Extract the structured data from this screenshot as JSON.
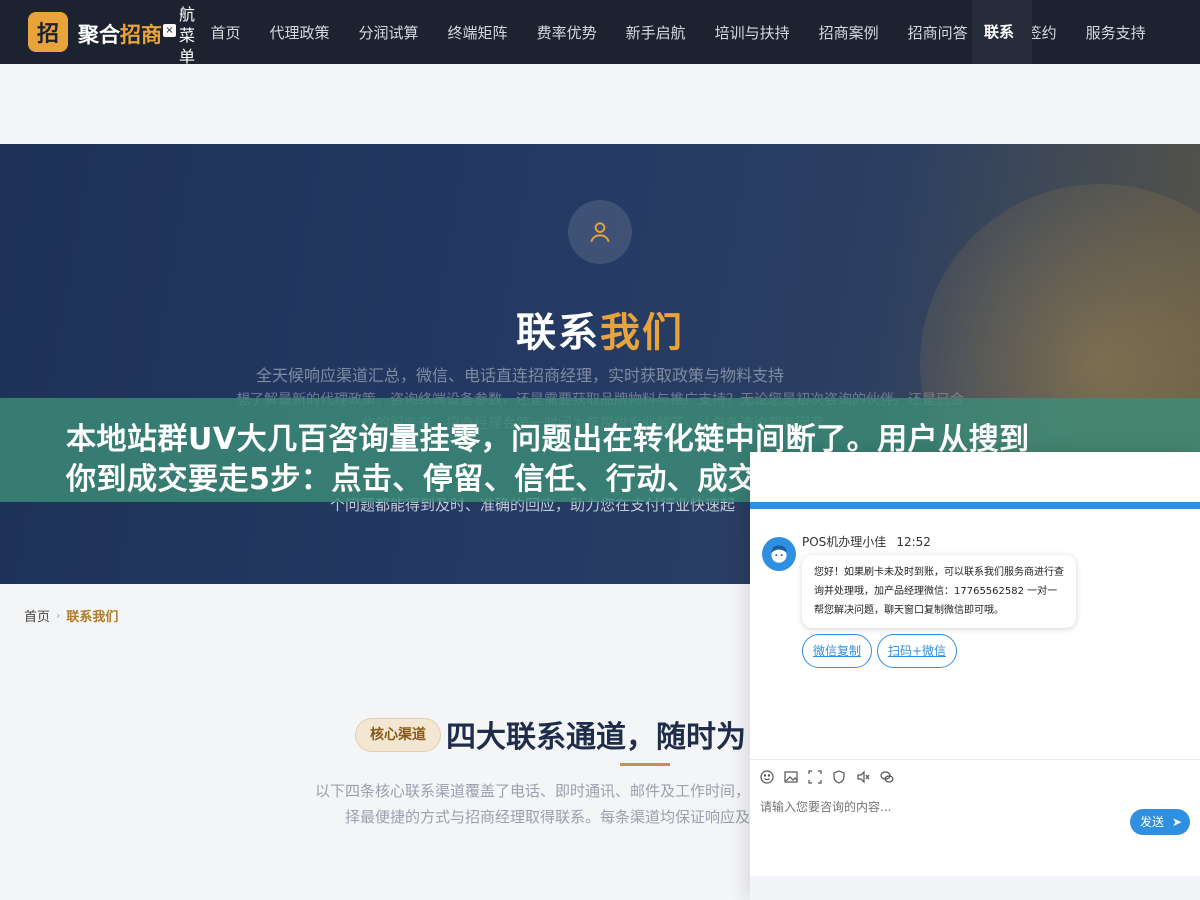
{
  "navbar": {
    "logo_mark": "招",
    "logo_text_plain": "聚合",
    "logo_text_accent": "招商",
    "close_glyph": "×",
    "toggle_label": "航菜单",
    "items": [
      {
        "label": "首页"
      },
      {
        "label": "代理政策"
      },
      {
        "label": "分润试算"
      },
      {
        "label": "终端矩阵"
      },
      {
        "label": "费率优势"
      },
      {
        "label": "新手启航"
      },
      {
        "label": "培训与扶持"
      },
      {
        "label": "招商案例"
      },
      {
        "label": "招商问答"
      },
      {
        "label": "在线签约"
      },
      {
        "label": "服务支持"
      }
    ],
    "active_item": "联系"
  },
  "hero": {
    "title_plain": "联系",
    "title_accent": "我们",
    "subtitle": "全天候响应渠道汇总，微信、电话直连招商经理，实时获取政策与物料支持",
    "description": "想了解最新的代理政策、咨询终端设备参数，还是需要获取品牌物料与推广支持？无论您是初次咨询的伙伴，还是已合作的服务商，招商经理会第一时间为您提供专业解答，让每条咨询都有回音。",
    "description_last": "个问题都能得到及时、准确的回应，助力您在支付行业快速起"
  },
  "ad_banner": {
    "line1": "本地站群UV大几百咨询量挂零，问题出在转化链中间断了。用户从搜到",
    "line2": "你到成交要走5步：点击、停留、信任、行动、成交。流量只解决了第一"
  },
  "breadcrumb": {
    "home": "首页",
    "separator": "›",
    "current": "联系我们"
  },
  "section": {
    "chip": "核心渠道",
    "title": "四大联系通道，随时为",
    "description": "以下四条核心联系渠道覆盖了电话、即时通讯、邮件及工作时间，您可根据自身需求选择最便捷的方式与招商经理取得联系。每条渠道均保证响应及时、服务专业。"
  },
  "chat": {
    "agent_name": "POS机办理小佳",
    "time": "12:52",
    "message": "您好！如果刷卡未及时到账，可以联系我们服务商进行查询并处理哦，加产品经理微信：17765562582 一对一帮您解决问题，聊天窗口复制微信即可哦。",
    "quick_replies": [
      "微信复制",
      "扫码+微信"
    ],
    "input_placeholder": "请输入您要咨询的内容...",
    "send_label": "发送",
    "minimize_glyph": "—",
    "maximize_glyph": "□",
    "tools": [
      "emoji-icon",
      "image-icon",
      "crop-icon",
      "shield-icon",
      "audio-icon",
      "wechat-icon"
    ]
  },
  "colors": {
    "nav_bg": "#1c2230",
    "accent_gold": "#e8a33a",
    "chat_blue": "#2f8fe0",
    "banner_green": "#3c8c78"
  }
}
